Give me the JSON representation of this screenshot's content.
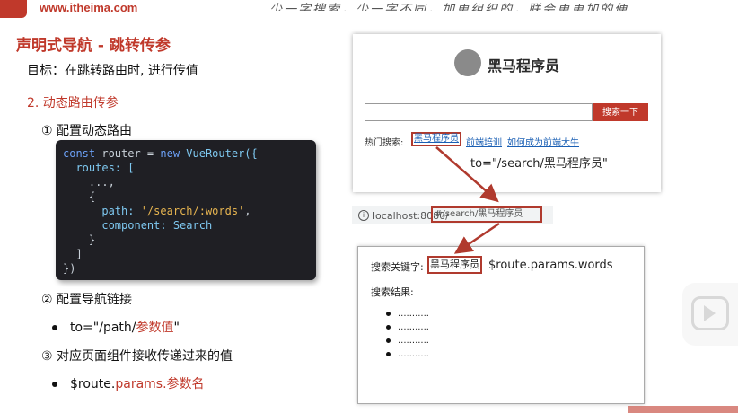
{
  "header": {
    "site": "www.itheima.com",
    "scribble": "少一字搜索，少一字不同，加更组织的，联会更更加的便"
  },
  "slide": {
    "title": "声明式导航 - 跳转传参",
    "goal": "目标：在跳转路由时, 进行传值",
    "section": "2. 动态路由传参",
    "step1": "① 配置动态路由",
    "code": {
      "l1_kw": "const",
      "l1_rest": " router = ",
      "l1_new": "new",
      "l1_cls": " VueRouter({",
      "l2": "  routes: [",
      "l3": "    ...,",
      "l4": "    {",
      "l5_key": "      path: ",
      "l5_val": "'/search/:words'",
      "l5_end": ",",
      "l6_key": "      component: ",
      "l6_val": "Search",
      "l7": "    }",
      "l8": "  ]",
      "l9": "})"
    },
    "step2": "② 配置导航链接",
    "bullet1_a": "to=\"/path/",
    "bullet1_b": "参数值",
    "bullet1_c": "\"",
    "step3": "③ 对应页面组件接收传递过来的值",
    "bullet2_a": "$route.",
    "bullet2_b": "params.参数名"
  },
  "search_demo": {
    "brand": "黑马程序员",
    "search_button": "搜索一下",
    "hot_label": "热门搜索:",
    "hot_links": [
      "黑马程序员",
      "前端培训",
      "如何成为前端大牛"
    ],
    "to_note": "to=\"/search/黑马程序员\""
  },
  "url_bar": {
    "host": "localhost:8080/",
    "path": "#/search/黑马程序员"
  },
  "result_demo": {
    "keyword_label": "搜索关键字:",
    "keyword_value": "黑马程序员",
    "keyword_expr": "$route.params.words",
    "result_label": "搜索结果:",
    "items": [
      "...........",
      "...........",
      "...........",
      "..........."
    ]
  },
  "colors": {
    "accent": "#c0392b",
    "code_bg": "#1f1f24",
    "link": "#1a5fb4"
  }
}
